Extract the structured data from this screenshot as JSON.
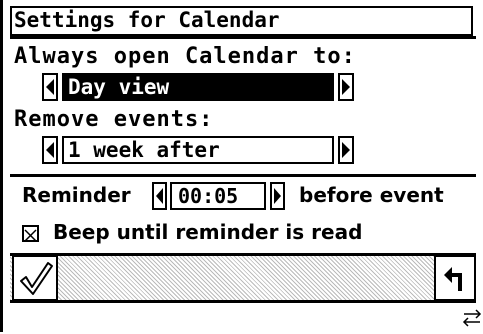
{
  "dialog": {
    "title": "Settings for Calendar"
  },
  "open_to": {
    "label": "Always open Calendar to:",
    "value": "Day view"
  },
  "remove_events": {
    "label": "Remove events:",
    "value": "1 week after"
  },
  "reminder": {
    "label": "Reminder",
    "value": "00:05",
    "suffix": "before event"
  },
  "beep": {
    "label": "Beep until reminder is read",
    "checked": true
  },
  "icons": [
    "checkmark-icon",
    "return-arrow-icon",
    "left-arrow-icon",
    "right-arrow-icon",
    "scroll-arrows-icon"
  ]
}
